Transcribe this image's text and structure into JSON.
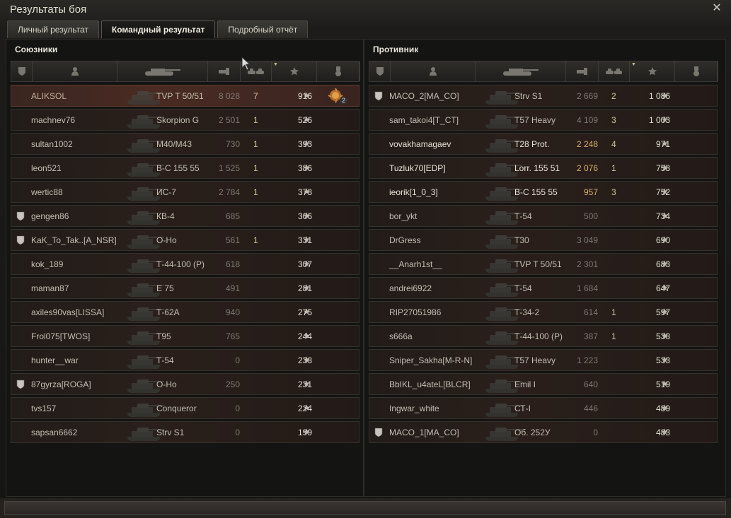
{
  "window": {
    "title": "Результаты боя",
    "close_icon": "close-icon"
  },
  "tabs": [
    {
      "label": "Личный результат",
      "active": false
    },
    {
      "label": "Командный результат",
      "active": true
    },
    {
      "label": "Подробный отчёт",
      "active": false
    }
  ],
  "allies": {
    "title": "Союзники",
    "rows": [
      {
        "name": "ALIKSOL",
        "vehicle": "TVP T 50/51",
        "damage": "8 028",
        "kills": "7",
        "xp": "916",
        "clan_icon": false,
        "self": true,
        "medal": {
          "icon": "medal-icon",
          "count": "2"
        }
      },
      {
        "name": "machnev76",
        "vehicle": "Skorpion G",
        "damage": "2 501",
        "kills": "1",
        "xp": "526",
        "clan_icon": false
      },
      {
        "name": "sultan1002",
        "vehicle": "M40/M43",
        "damage": "730",
        "kills": "1",
        "xp": "393",
        "clan_icon": false
      },
      {
        "name": "leon521",
        "vehicle": "В-С 155 55",
        "damage": "1 525",
        "kills": "1",
        "xp": "386",
        "clan_icon": false
      },
      {
        "name": "wertic88",
        "vehicle": "ИС-7",
        "damage": "2 784",
        "kills": "1",
        "xp": "378",
        "clan_icon": false
      },
      {
        "name": "gengen86",
        "vehicle": "КВ-4",
        "damage": "685",
        "kills": "",
        "xp": "366",
        "clan_icon": true
      },
      {
        "name": "KaK_To_Tak..[A_NSR]",
        "vehicle": "О-Но",
        "damage": "561",
        "kills": "1",
        "xp": "331",
        "clan_icon": true
      },
      {
        "name": "kok_189",
        "vehicle": "Т-44-100 (Р)",
        "damage": "618",
        "kills": "",
        "xp": "307",
        "clan_icon": false
      },
      {
        "name": "maman87",
        "vehicle": "E 75",
        "damage": "491",
        "kills": "",
        "xp": "281",
        "clan_icon": false
      },
      {
        "name": "axiles90vas[LISSA]",
        "vehicle": "Т-62А",
        "damage": "940",
        "kills": "",
        "xp": "275",
        "clan_icon": false
      },
      {
        "name": "Frol075[TWOS]",
        "vehicle": "T95",
        "damage": "765",
        "kills": "",
        "xp": "244",
        "clan_icon": false
      },
      {
        "name": "hunter__war",
        "vehicle": "Т-54",
        "damage": "0",
        "kills": "",
        "xp": "238",
        "clan_icon": false
      },
      {
        "name": "87gyrza[ROGA]",
        "vehicle": "О-Но",
        "damage": "250",
        "kills": "",
        "xp": "231",
        "clan_icon": true
      },
      {
        "name": "tvs157",
        "vehicle": "Conqueror",
        "damage": "0",
        "kills": "",
        "xp": "224",
        "clan_icon": false
      },
      {
        "name": "sapsan6662",
        "vehicle": "Strv S1",
        "damage": "0",
        "kills": "",
        "xp": "199",
        "clan_icon": false
      }
    ]
  },
  "enemies": {
    "title": "Противник",
    "rows": [
      {
        "name": "MACO_2[MA_CO]",
        "vehicle": "Strv S1",
        "damage": "2 669",
        "kills": "2",
        "xp": "1 086",
        "clan_icon": true
      },
      {
        "name": "sam_takoi4[T_CT]",
        "vehicle": "T57 Heavy",
        "damage": "4 109",
        "kills": "3",
        "xp": "1 003",
        "clan_icon": false
      },
      {
        "name": "vovakhamagaev",
        "vehicle": "T28 Prot.",
        "damage": "2 248",
        "kills": "4",
        "xp": "971",
        "clan_icon": false,
        "bright": true,
        "damage_hi": true
      },
      {
        "name": "Tuzluk70[EDP]",
        "vehicle": "Lorr. 155 51",
        "damage": "2 076",
        "kills": "1",
        "xp": "758",
        "clan_icon": false,
        "bright": true,
        "damage_hi": true
      },
      {
        "name": "ieorik[1_0_3]",
        "vehicle": "В-С 155 55",
        "damage": "957",
        "kills": "3",
        "xp": "752",
        "clan_icon": false,
        "bright": true,
        "damage_hi": true
      },
      {
        "name": "bor_ykt",
        "vehicle": "Т-54",
        "damage": "500",
        "kills": "",
        "xp": "734",
        "clan_icon": false
      },
      {
        "name": "DrGress",
        "vehicle": "T30",
        "damage": "3 049",
        "kills": "",
        "xp": "690",
        "clan_icon": false
      },
      {
        "name": "__Anarh1st__",
        "vehicle": "TVP T 50/51",
        "damage": "2 301",
        "kills": "",
        "xp": "683",
        "clan_icon": false
      },
      {
        "name": "andrei6922",
        "vehicle": "Т-54",
        "damage": "1 684",
        "kills": "",
        "xp": "647",
        "clan_icon": false
      },
      {
        "name": "RIP27051986",
        "vehicle": "Т-34-2",
        "damage": "614",
        "kills": "1",
        "xp": "597",
        "clan_icon": false
      },
      {
        "name": "s666a",
        "vehicle": "Т-44-100 (Р)",
        "damage": "387",
        "kills": "1",
        "xp": "538",
        "clan_icon": false
      },
      {
        "name": "Sniper_Sakha[M-R-N]",
        "vehicle": "T57 Heavy",
        "damage": "1 223",
        "kills": "",
        "xp": "533",
        "clan_icon": false
      },
      {
        "name": "BbIKL_u4ateL[BLCR]",
        "vehicle": "Emil I",
        "damage": "640",
        "kills": "",
        "xp": "519",
        "clan_icon": false
      },
      {
        "name": "Ingwar_white",
        "vehicle": "СТ-I",
        "damage": "446",
        "kills": "",
        "xp": "489",
        "clan_icon": false
      },
      {
        "name": "MACO_1[MA_CO]",
        "vehicle": "Об. 252У",
        "damage": "0",
        "kills": "",
        "xp": "483",
        "clan_icon": true
      }
    ]
  },
  "columns": [
    {
      "icon": "squad-shield-icon"
    },
    {
      "icon": "player-icon"
    },
    {
      "icon": "tank-icon"
    },
    {
      "icon": "damage-icon"
    },
    {
      "icon": "destroyed-tanks-icon"
    },
    {
      "icon": "experience-star-icon",
      "sorted": true
    },
    {
      "icon": "medal-column-icon"
    }
  ],
  "colors": {
    "accent": "#d9b06a",
    "self_row": "#4a2b23",
    "text": "#c3bfb3"
  }
}
